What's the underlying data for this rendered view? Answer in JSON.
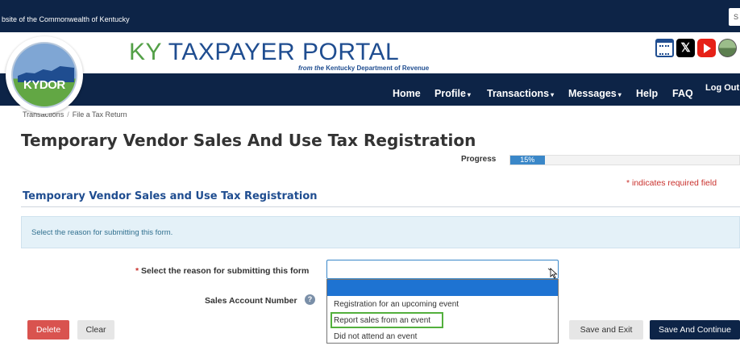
{
  "gov_bar": {
    "text": "bsite of the Commonwealth of Kentucky",
    "search_text": "S"
  },
  "header": {
    "title_ky": "KY",
    "title_rest": " TAXPAYER PORTAL",
    "subtitle_from": "from the",
    "subtitle_rest": " Kentucky Department of Revenue",
    "logo_text": "KYDOR",
    "x_glyph": "𝕏"
  },
  "nav": {
    "items": [
      "Home",
      "Profile",
      "Transactions",
      "Messages",
      "Help",
      "FAQ"
    ],
    "caret": "▾",
    "logout": "Log Out"
  },
  "breadcrumb": {
    "items": [
      "Transactions",
      "File a Tax Return"
    ],
    "separator": "/"
  },
  "page": {
    "title": "Temporary Vendor Sales And Use Tax Registration",
    "required_note": "* indicates required field",
    "section_title": "Temporary Vendor Sales and Use Tax Registration",
    "info_text": "Select the reason for submitting this form."
  },
  "progress": {
    "label": "Progress",
    "value_text": "15%",
    "value": 0.15
  },
  "form": {
    "required_mark": "*",
    "reason_label": " Select the reason for submitting this form",
    "reason_value": "",
    "reason_options": [
      "Registration for an upcoming event",
      "Report sales from an event",
      "Did not attend an event"
    ],
    "account_label": "Sales Account Number",
    "help_glyph": "?"
  },
  "buttons": {
    "delete": "Delete",
    "clear": "Clear",
    "save_exit": "Save and Exit",
    "save_continue": "Save And Continue"
  },
  "colors": {
    "navy": "#0d2447",
    "brand_blue": "#1f4d90",
    "brand_green": "#53a047",
    "progress": "#3a87c8",
    "danger": "#d9534f",
    "highlight_outline": "#53b03d"
  }
}
